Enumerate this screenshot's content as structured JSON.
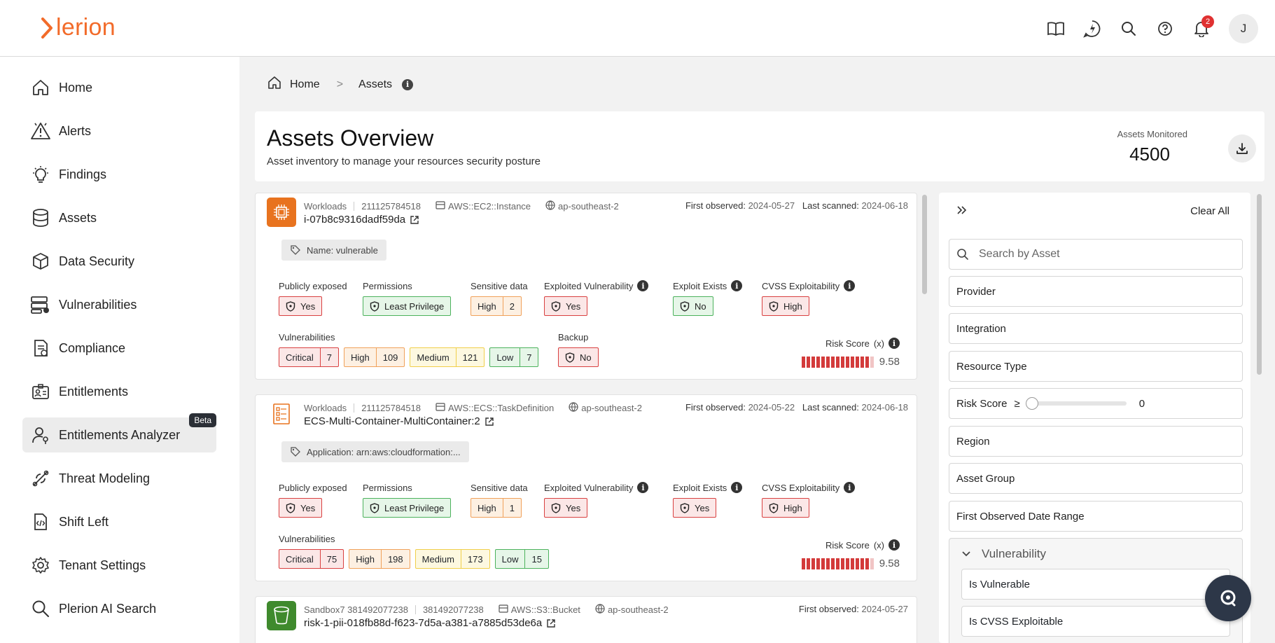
{
  "app": {
    "brand": "Plerion",
    "logo_text": "lerion",
    "notifications_count": "2",
    "avatar_initial": "J"
  },
  "colors": {
    "brand": "#f26b2a",
    "critical": "#d94040",
    "high": "#f0a15a",
    "medium": "#f0cf4a",
    "low": "#4cb25c"
  },
  "sidebar": {
    "items": [
      {
        "label": "Home",
        "icon": "home-icon"
      },
      {
        "label": "Alerts",
        "icon": "alert-icon"
      },
      {
        "label": "Findings",
        "icon": "lightbulb-icon"
      },
      {
        "label": "Assets",
        "icon": "database-icon"
      },
      {
        "label": "Data Security",
        "icon": "cube-icon"
      },
      {
        "label": "Vulnerabilities",
        "icon": "server-bug-icon"
      },
      {
        "label": "Compliance",
        "icon": "compliance-icon"
      },
      {
        "label": "Entitlements",
        "icon": "id-card-icon"
      },
      {
        "label": "Entitlements Analyzer",
        "icon": "user-key-icon",
        "badge": "Beta"
      },
      {
        "label": "Threat Modeling",
        "icon": "threat-icon"
      },
      {
        "label": "Shift Left",
        "icon": "code-file-icon"
      },
      {
        "label": "Tenant Settings",
        "icon": "gear-icon"
      },
      {
        "label": "Plerion AI Search",
        "icon": "search-icon"
      }
    ]
  },
  "breadcrumb": {
    "home": "Home",
    "sep": ">",
    "current": "Assets",
    "info": "i"
  },
  "overview": {
    "title": "Assets Overview",
    "subtitle": "Asset inventory to manage your resources security posture",
    "monitored_label": "Assets Monitored",
    "monitored_value": "4500"
  },
  "labels": {
    "first_observed": "First observed:",
    "last_scanned": "Last scanned:",
    "publicly_exposed": "Publicly exposed",
    "permissions": "Permissions",
    "sensitive_data": "Sensitive data",
    "exploited_vulnerability": "Exploited Vulnerability",
    "exploit_exists": "Exploit Exists",
    "cvss_exploitability": "CVSS Exploitability",
    "vulnerabilities": "Vulnerabilities",
    "backup": "Backup",
    "risk_score": "Risk Score",
    "risk_symbol": "(x)",
    "info": "i",
    "critical": "Critical",
    "high": "High",
    "medium": "Medium",
    "low": "Low"
  },
  "assets": [
    {
      "category": "Workloads",
      "account": "211125784518",
      "resource_type": "AWS::EC2::Instance",
      "region": "ap-southeast-2",
      "first_observed": "2024-05-27",
      "last_scanned": "2024-06-18",
      "id": "i-07b8c9316dadf59da",
      "tag": "Name: vulnerable",
      "publicly_exposed": "Yes",
      "permissions": "Least Privilege",
      "sensitive_data_level": "High",
      "sensitive_data_count": "2",
      "exploited_vulnerability": "Yes",
      "exploit_exists": "No",
      "cvss_exploitability": "High",
      "vuln_critical": "7",
      "vuln_high": "109",
      "vuln_medium": "121",
      "vuln_low": "7",
      "backup": "No",
      "risk_score": "9.58",
      "risk_fraction": 0.958
    },
    {
      "category": "Workloads",
      "account": "211125784518",
      "resource_type": "AWS::ECS::TaskDefinition",
      "region": "ap-southeast-2",
      "first_observed": "2024-05-22",
      "last_scanned": "2024-06-18",
      "id": "ECS-Multi-Container-MultiContainer:2",
      "tag": "Application: arn:aws:cloudformation:...",
      "publicly_exposed": "Yes",
      "permissions": "Least Privilege",
      "sensitive_data_level": "High",
      "sensitive_data_count": "1",
      "exploited_vulnerability": "Yes",
      "exploit_exists": "Yes",
      "cvss_exploitability": "High",
      "vuln_critical": "75",
      "vuln_high": "198",
      "vuln_medium": "173",
      "vuln_low": "15",
      "risk_score": "9.58",
      "risk_fraction": 0.958
    },
    {
      "category": "Sandbox7 381492077238",
      "account": "381492077238",
      "resource_type": "AWS::S3::Bucket",
      "region": "ap-southeast-2",
      "first_observed": "2024-05-27",
      "id": "risk-1-pii-018fb88d-f623-7d5a-a381-a7885d53de6a"
    }
  ],
  "filters": {
    "clear_all": "Clear All",
    "search_placeholder": "Search by Asset",
    "provider": "Provider",
    "integration": "Integration",
    "resource_type": "Resource Type",
    "risk_score": "Risk Score",
    "risk_operator": "≥",
    "risk_value": "0",
    "region": "Region",
    "asset_group": "Asset Group",
    "first_observed_range": "First Observed Date Range",
    "vulnerability": "Vulnerability",
    "is_vulnerable": "Is Vulnerable",
    "is_cvss_exploitable": "Is CVSS Exploitable"
  }
}
